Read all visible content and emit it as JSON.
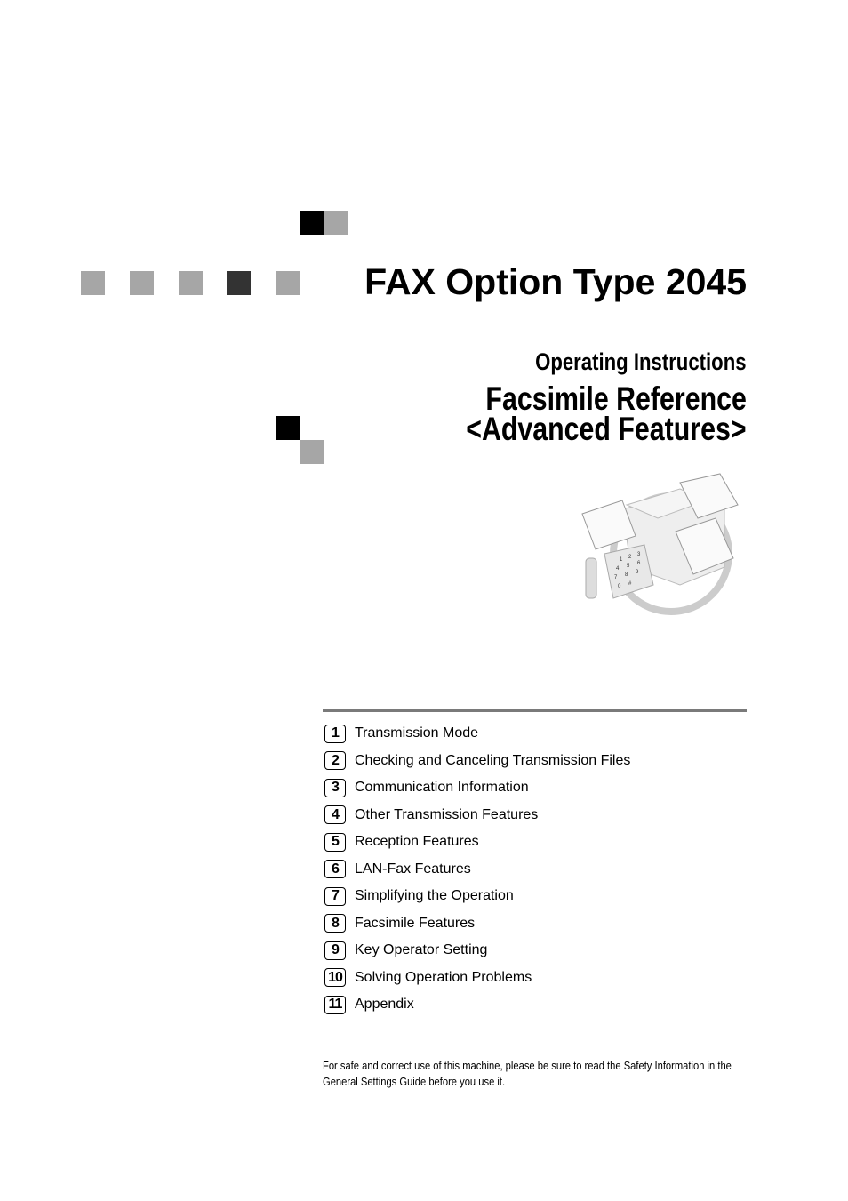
{
  "cover": {
    "title": "FAX Option Type 2045",
    "subtitle": "Operating Instructions",
    "reference_line1": "Facsimile Reference",
    "reference_line2": "<Advanced Features>"
  },
  "toc": [
    {
      "num": "1",
      "label": "Transmission Mode"
    },
    {
      "num": "2",
      "label": "Checking and Canceling Transmission Files"
    },
    {
      "num": "3",
      "label": "Communication Information"
    },
    {
      "num": "4",
      "label": "Other Transmission Features"
    },
    {
      "num": "5",
      "label": "Reception Features"
    },
    {
      "num": "6",
      "label": "LAN-Fax Features"
    },
    {
      "num": "7",
      "label": "Simplifying the Operation"
    },
    {
      "num": "8",
      "label": "Facsimile Features"
    },
    {
      "num": "9",
      "label": "Key Operator Setting"
    },
    {
      "num": "10",
      "label": "Solving Operation Problems"
    },
    {
      "num": "11",
      "label": "Appendix"
    }
  ],
  "footer": "For safe and correct use of this machine, please be sure to read the Safety Information in the General Settings Guide before you use it.",
  "illustration": {
    "keypad": [
      "1",
      "2",
      "3",
      "4",
      "5",
      "6",
      "7",
      "8",
      "9",
      "0",
      "#"
    ]
  }
}
